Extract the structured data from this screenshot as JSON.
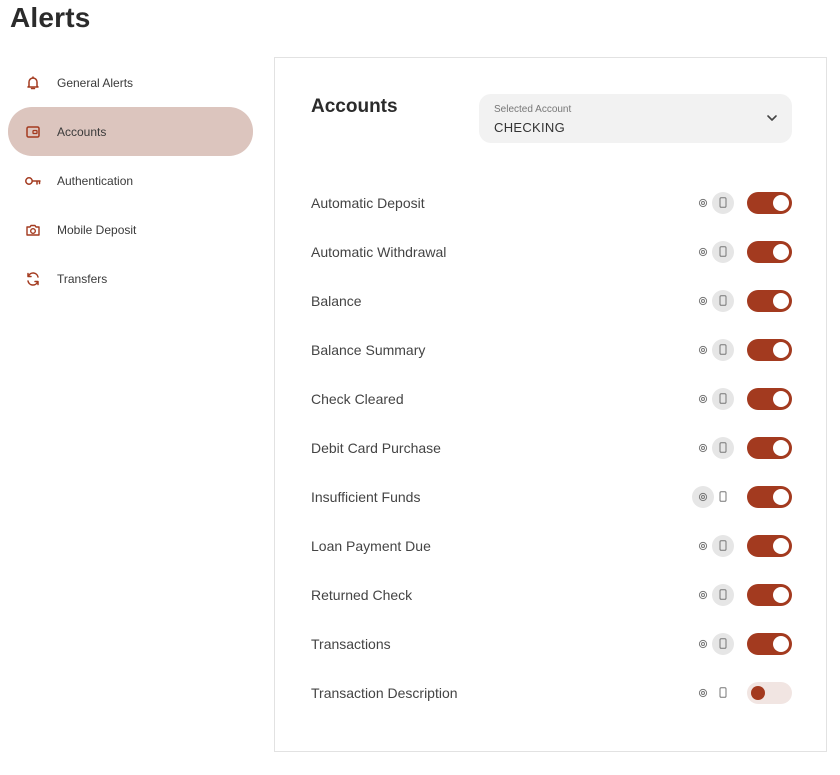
{
  "page": {
    "title": "Alerts"
  },
  "colors": {
    "accent": "#a33a1f",
    "active_nav": "#dcc5be",
    "panel_border": "#e2e2e2"
  },
  "sidebar": {
    "items": [
      {
        "label": "General Alerts",
        "icon": "bell-icon",
        "active": false
      },
      {
        "label": "Accounts",
        "icon": "wallet-icon",
        "active": true
      },
      {
        "label": "Authentication",
        "icon": "key-icon",
        "active": false
      },
      {
        "label": "Mobile Deposit",
        "icon": "camera-icon",
        "active": false
      },
      {
        "label": "Transfers",
        "icon": "transfer-arrows-icon",
        "active": false
      }
    ]
  },
  "panel": {
    "title": "Accounts",
    "account_select": {
      "caption": "Selected Account",
      "value": "CHECKING",
      "icon": "chevron-down-icon"
    },
    "alerts": [
      {
        "label": "Automatic Deposit",
        "channel": "phone",
        "enabled": true
      },
      {
        "label": "Automatic Withdrawal",
        "channel": "phone",
        "enabled": true
      },
      {
        "label": "Balance",
        "channel": "phone",
        "enabled": true
      },
      {
        "label": "Balance Summary",
        "channel": "phone",
        "enabled": true
      },
      {
        "label": "Check Cleared",
        "channel": "phone",
        "enabled": true
      },
      {
        "label": "Debit Card Purchase",
        "channel": "phone",
        "enabled": true
      },
      {
        "label": "Insufficient Funds",
        "channel": "email",
        "enabled": true
      },
      {
        "label": "Loan Payment Due",
        "channel": "phone",
        "enabled": true
      },
      {
        "label": "Returned Check",
        "channel": "phone",
        "enabled": true
      },
      {
        "label": "Transactions",
        "channel": "phone",
        "enabled": true
      },
      {
        "label": "Transaction Description",
        "channel": "none",
        "enabled": false
      }
    ]
  }
}
